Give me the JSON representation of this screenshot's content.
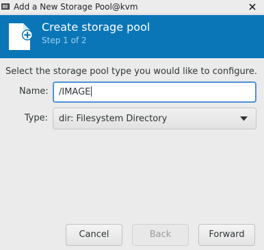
{
  "window": {
    "title": "Add a New Storage Pool@kvm"
  },
  "header": {
    "title": "Create storage pool",
    "subtitle": "Step 1 of 2"
  },
  "form": {
    "instruction": "Select the storage pool type you would like to configure.",
    "name_label": "Name:",
    "name_value": "/IMAGE",
    "type_label": "Type:",
    "type_value": "dir: Filesystem Directory"
  },
  "buttons": {
    "cancel": "Cancel",
    "back": "Back",
    "forward": "Forward"
  },
  "colors": {
    "header_bg": "#0b76b7",
    "focus_border": "#4a90d9"
  },
  "icons": {
    "app": "app-window-icon",
    "close": "close-icon",
    "header": "new-document-icon",
    "dropdown": "dropdown-arrow-icon"
  }
}
